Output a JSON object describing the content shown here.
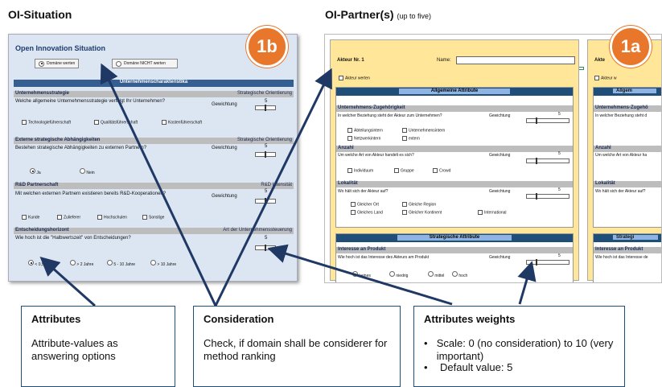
{
  "headers": {
    "left": "OI-Situation",
    "right": "OI-Partner(s)",
    "right_note": "(up to five)"
  },
  "badges": {
    "b1b": "1b",
    "b1a": "1a"
  },
  "situation": {
    "title": "Open Innovation Situation",
    "radio_eval": "Domäne werten",
    "radio_noeval": "Domäne NICHT werten",
    "section_title": "Unternehmenscharakteristika",
    "gewichtung": "Gewichtung",
    "five": "5",
    "s1": {
      "title": "Unternehmensstrategie",
      "right": "Strategische Orientierung",
      "q": "Welche allgemeine Unternehmensstrategie verfolgt Ihr Unternehmen?",
      "opts": [
        "Technologieführerschaft",
        "Qualitätsführerschaft",
        "Kostenführerschaft"
      ]
    },
    "s2": {
      "title": "Externe strategische Abhängigkeiten",
      "right": "Strategische Orientierung",
      "q": "Bestehen strategische Abhängigkeiten zu externen Partnern?",
      "opts": [
        "Ja",
        "Nein"
      ]
    },
    "s3": {
      "title": "R&D Partnerschaft",
      "right": "R&D Intensität",
      "q": "Mit welchen externen Partnern existieren bereits R&D-Kooperationen?",
      "opts": [
        "Kunde",
        "Zulieferer",
        "Hochschulen",
        "Sonstige"
      ]
    },
    "s4": {
      "title": "Entscheidungshorizont",
      "right": "Art der Unternehmenssteuerung",
      "q": "Wie hoch ist die \"Halbwertszeit\" von Entscheidungen?",
      "opts": [
        "< 0,5 Jahre",
        "> 2 Jahre",
        "5 - 10 Jahre",
        "> 10 Jahre"
      ]
    }
  },
  "partner": {
    "akteur": "Akteur Nr. 1",
    "name_label": "Name:",
    "werten": "Akteur werten",
    "allg": "Allgemeine Attribute",
    "strat": "Strategische Attribute",
    "gewichtung": "Gewichtung",
    "five": "5",
    "a1": {
      "title": "Unternehmens-Zugehörigkeit",
      "q": "In welcher Beziehung steht der Akteur zum Unternehmen?",
      "opts": [
        "Abteilungsintern",
        "Unternehmensintern",
        "Netzwerkintern",
        "extern"
      ]
    },
    "a2": {
      "title": "Anzahl",
      "q": "Um welche Art von Akteur handelt es sich?",
      "opts": [
        "Individuum",
        "Gruppe",
        "Crowd"
      ]
    },
    "a3": {
      "title": "Lokalität",
      "q": "Wo hält sich der Akteur auf?",
      "opts": [
        "Gleicher Ort",
        "Gleiche Region",
        "Gleiches Land",
        "Gleicher Kontinent",
        "International"
      ]
    },
    "a4": {
      "title": "Interesse an Produkt",
      "q": "Wie hoch ist das Interesse des Akteurs am Produkt",
      "opts": [
        "keines",
        "niedrig",
        "mittel",
        "hoch"
      ]
    },
    "akteur2": "Akte",
    "werten2": "Akteur w",
    "a1q2": "In welcher Beziehung steht d",
    "a2q2": "Um welche Art von Akteur ha",
    "a3q2": "Wo hält sich der Akteur auf?",
    "a4q2": "Wie hoch ist das Interesse de",
    "a1t2": "Unternehmens-Zugehö",
    "a4t2": "Interesse an Produkt",
    "allg2": "Allgem",
    "strat2": "Strategi"
  },
  "callouts": {
    "attributes": {
      "title": "Attributes",
      "text": "Attribute-values as answering options"
    },
    "consideration": {
      "title": "Consideration",
      "text": "Check, if domain shall be considerer for method ranking"
    },
    "weights": {
      "title": "Attributes weights",
      "items": [
        "Scale: 0 (no consideration) to 10 (very important)",
        "Default value: 5"
      ]
    }
  }
}
